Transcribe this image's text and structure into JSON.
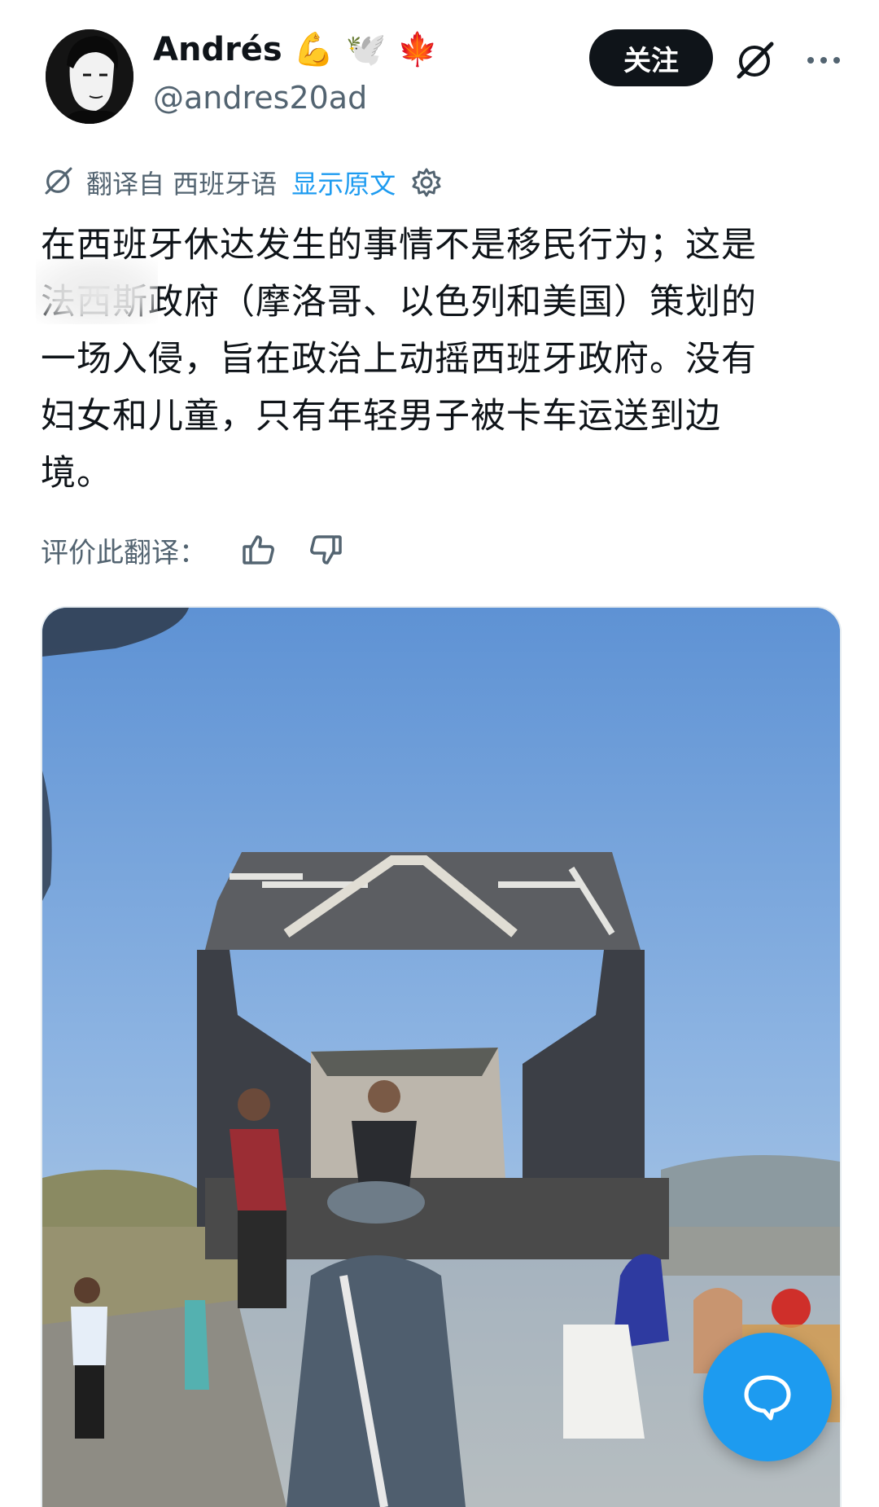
{
  "author": {
    "display_name": "Andrés",
    "emojis": [
      "💪",
      "🕊️",
      "🍁"
    ],
    "handle": "@andres20ad"
  },
  "actions": {
    "follow_label": "关注"
  },
  "translation": {
    "label": "翻译自 西班牙语",
    "show_original": "显示原文"
  },
  "tweet": {
    "lines": [
      "在西班牙休达发生的事情不是移民行为；这是",
      "法西斯政府（摩洛哥、以色列和美国）策划的",
      "一场入侵，旨在政治上动摇西班牙政府。没有",
      "妇女和儿童，只有年轻男子被卡车运送到边",
      "境。"
    ]
  },
  "rating": {
    "label": "评价此翻译："
  },
  "colors": {
    "accent": "#1d9bf0",
    "text": "#0f1419",
    "muted": "#536471",
    "follow_bg": "#0f1419"
  },
  "icons": {
    "grok": "grok-icon",
    "more": "more-dots-icon",
    "translate": "grok-icon",
    "settings": "gear-icon",
    "like": "thumbs-up-icon",
    "dislike": "thumbs-down-icon",
    "fab": "chat-bubble-icon"
  }
}
